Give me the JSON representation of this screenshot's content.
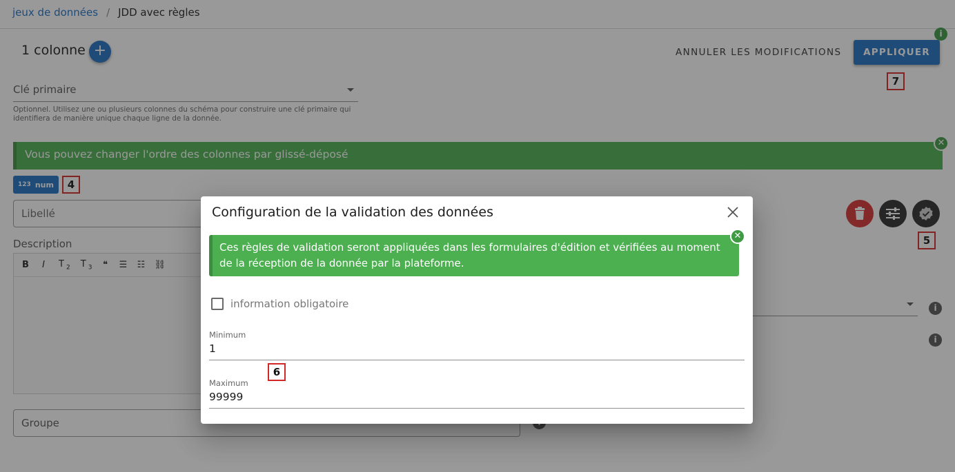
{
  "breadcrumb": {
    "parent": "jeux de données",
    "separator": "/",
    "current": "JDD avec règles"
  },
  "header": {
    "columns_title": "1 colonne",
    "add_column_icon": "plus-icon",
    "cancel_label": "ANNULER LES MODIFICATIONS",
    "apply_label": "APPLIQUER",
    "info_badge": "i"
  },
  "primary_key": {
    "label": "Clé primaire",
    "hint": "Optionnel. Utilisez une ou plusieurs colonnes du schéma pour construire une clé primaire qui identifiera de manière unique chaque ligne de la donnée."
  },
  "drag_alert": {
    "text": "Vous pouvez changer l'ordre des colonnes par glissé-déposé",
    "close_glyph": "✕"
  },
  "column": {
    "type_icon_text": "123",
    "type_label": "num",
    "label_placeholder": "Libellé",
    "description_label": "Description",
    "group_placeholder": "Groupe",
    "action_icons": [
      "delete-icon",
      "settings-sliders-icon",
      "verified-badge-icon"
    ]
  },
  "editor_toolbar": {
    "bold": "B",
    "italic": "I",
    "heading2": "T",
    "heading2_sub": "2",
    "heading3": "T",
    "heading3_sub": "3",
    "quote": "❝",
    "bullet_list": "☰",
    "ordered_list": "☷",
    "link": "⛓"
  },
  "markers": {
    "m4": "4",
    "m5": "5",
    "m6": "6",
    "m7": "7"
  },
  "dialog": {
    "title": "Configuration de la validation des données",
    "close_glyph": "✕",
    "alert_text": "Ces règles de validation seront appliquées dans les formulaires d'édition et vérifiées au moment de la réception de la donnée par la plateforme.",
    "alert_close_glyph": "✕",
    "required_label": "information obligatoire",
    "required_checked": false,
    "min_label": "Minimum",
    "min_value": "1",
    "max_label": "Maximum",
    "max_value": "99999"
  },
  "colors": {
    "primary": "#1e6fc4",
    "success": "#4caf50",
    "danger": "#d63030",
    "dark": "#2c2c2c"
  }
}
